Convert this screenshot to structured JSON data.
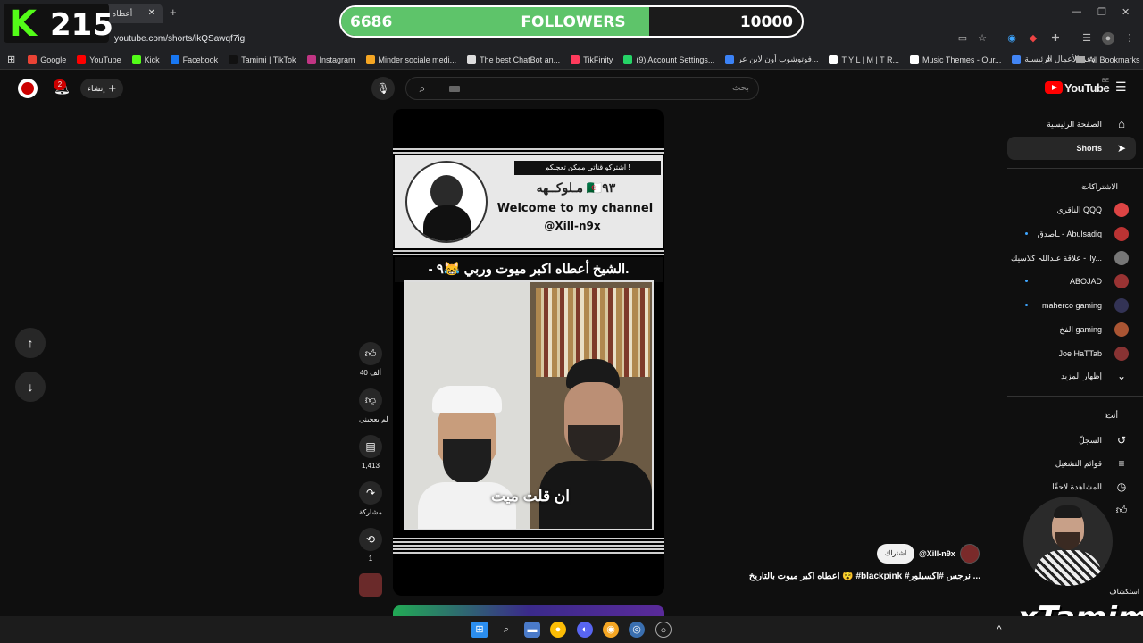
{
  "browser": {
    "tab_title": "(2) أعطاه",
    "address": "youtube.com/shorts/ikQSawqf7ig",
    "bookmarks": [
      {
        "label": "Google",
        "color": "#ea4335"
      },
      {
        "label": "YouTube",
        "color": "#ff0000"
      },
      {
        "label": "Kick",
        "color": "#53fc18"
      },
      {
        "label": "Facebook",
        "color": "#1877f2"
      },
      {
        "label": "Tamimi | TikTok",
        "color": "#111111"
      },
      {
        "label": "Instagram",
        "color": "#c13584"
      },
      {
        "label": "Minder sociale medi...",
        "color": "#f5a623"
      },
      {
        "label": "The best ChatBot an...",
        "color": "#dddddd"
      },
      {
        "label": "TikFinity",
        "color": "#ff3b5c"
      },
      {
        "label": "(9) Account Settings...",
        "color": "#25d366"
      },
      {
        "label": "فوتوشوب أون لاين عر...",
        "color": "#3b82f6"
      },
      {
        "label": "T Y L | M | T R...",
        "color": "#ffffff"
      },
      {
        "label": "Music Themes - Our...",
        "color": "#ffffff"
      },
      {
        "label": "دعم الأعمال الرئيسية",
        "color": "#4285f4"
      }
    ],
    "all_bookmarks": "All Bookmarks"
  },
  "overlay": {
    "followers_current": "6686",
    "followers_label": "FOLLOWERS",
    "followers_goal": "10000",
    "followers_progress": 0.6686,
    "kick_letter": "K",
    "kick_count": "215",
    "watermark": "xTamimi"
  },
  "header": {
    "create_label": "إنشاء",
    "notification_count": "2",
    "search_placeholder": "بحث",
    "logo": "YouTube",
    "logo_region": "BE"
  },
  "sidebar": {
    "home": "الصفحة الرئيسية",
    "shorts": "Shorts",
    "subscriptions_title": "الاشتراكات",
    "subscriptions": [
      {
        "name": "الناقري QQQ",
        "color": "#d44",
        "dot": false
      },
      {
        "name": "ـاصدق - Abulsadiq",
        "color": "#b33",
        "dot": true
      },
      {
        "name": "علاقة عبداللہ كلاسيك - ily...",
        "color": "#777",
        "dot": false
      },
      {
        "name": "ABOJAD",
        "color": "#933",
        "dot": true
      },
      {
        "name": "maherco gaming",
        "color": "#335",
        "dot": true
      },
      {
        "name": "الفخ gaming",
        "color": "#a53",
        "dot": false
      },
      {
        "name": "Joe HaTTab",
        "color": "#833",
        "dot": false
      }
    ],
    "show_more": "إظهار المزيد",
    "you_title": "أنت",
    "you_items": [
      "السجلّ",
      "قوائم التشغيل",
      "المشاهدة لاحقًا"
    ],
    "explore_label": "استكشاف"
  },
  "video": {
    "banner_top": "اشتركو قناتي ممكن تعجبكم !",
    "banner_name": "مـلوكــهه 🇩🇿٩٣",
    "banner_welcome": "Welcome to my channel",
    "banner_handle": "@Xill-n9x",
    "headline": "- الشيخ أعطاه اكبر ميوت وربي 😹٩.",
    "subtitle": "ان قلت ميت",
    "channel_handle": "@Xill-n9x",
    "subscribe_label": "اشتراك",
    "description": "أعطاه اكبر ميوت بالتاريخ 😵 #blackpink #نرجس #اكسبلور ..."
  },
  "actions": {
    "like_count": "40 ألف",
    "dislike_label": "لم يعجبني",
    "comment_count": "1,413",
    "share_label": "مشاركة",
    "remix_count": "1"
  }
}
